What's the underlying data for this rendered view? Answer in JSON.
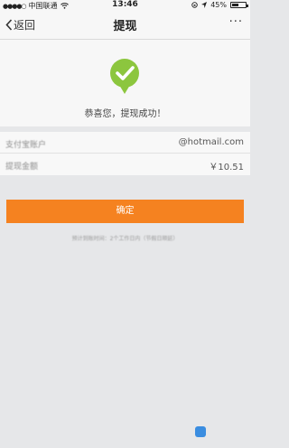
{
  "status_bar": {
    "carrier": "中国联通",
    "time": "13:46",
    "battery_percent": "45%",
    "battery_level": 0.45
  },
  "nav": {
    "back_label": "返回",
    "title": "提现",
    "more_label": "···"
  },
  "success": {
    "message": "恭喜您，提现成功！",
    "accent_color": "#8cc63e"
  },
  "details": [
    {
      "label": "支付宝账户",
      "value": "@hotmail.com"
    },
    {
      "label": "提现金额",
      "value": "￥10.51"
    }
  ],
  "actions": {
    "confirm_label": "确定",
    "confirm_color": "#f58220"
  },
  "note": "预计到账时间：2个工作日内（节假日顺延）"
}
